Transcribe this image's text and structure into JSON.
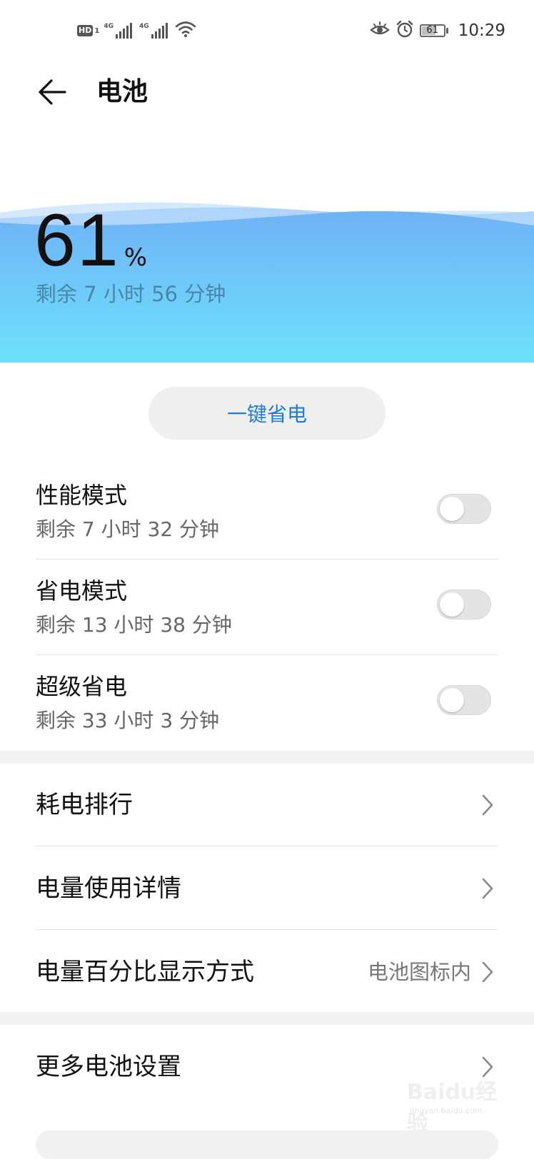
{
  "status_bar": {
    "hd_label": "HD",
    "hd_sub": "1",
    "sim1_tag": "4G",
    "sim2_tag": "4G",
    "battery_level": "61",
    "time": "10:29"
  },
  "header": {
    "title": "电池"
  },
  "battery": {
    "percent": "61",
    "percent_unit": "%",
    "remaining": "剩余 7 小时 56 分钟"
  },
  "one_key_save_label": "一键省电",
  "modes": [
    {
      "title": "性能模式",
      "remaining": "剩余 7 小时 32 分钟",
      "enabled": false
    },
    {
      "title": "省电模式",
      "remaining": "剩余 13 小时 38 分钟",
      "enabled": false
    },
    {
      "title": "超级省电",
      "remaining": "剩余 33 小时 3 分钟",
      "enabled": false
    }
  ],
  "list": [
    {
      "label": "耗电排行"
    },
    {
      "label": "电量使用详情"
    },
    {
      "label": "电量百分比显示方式",
      "value": "电池图标内"
    }
  ],
  "more": {
    "label": "更多电池设置"
  },
  "watermark": {
    "logo": "Baidu经验",
    "sub": "jingyan.baidu.com"
  },
  "colors": {
    "accent": "#1f7bd9",
    "wave_top": "#6fb2f7",
    "wave_bottom": "#6ee1fb"
  }
}
